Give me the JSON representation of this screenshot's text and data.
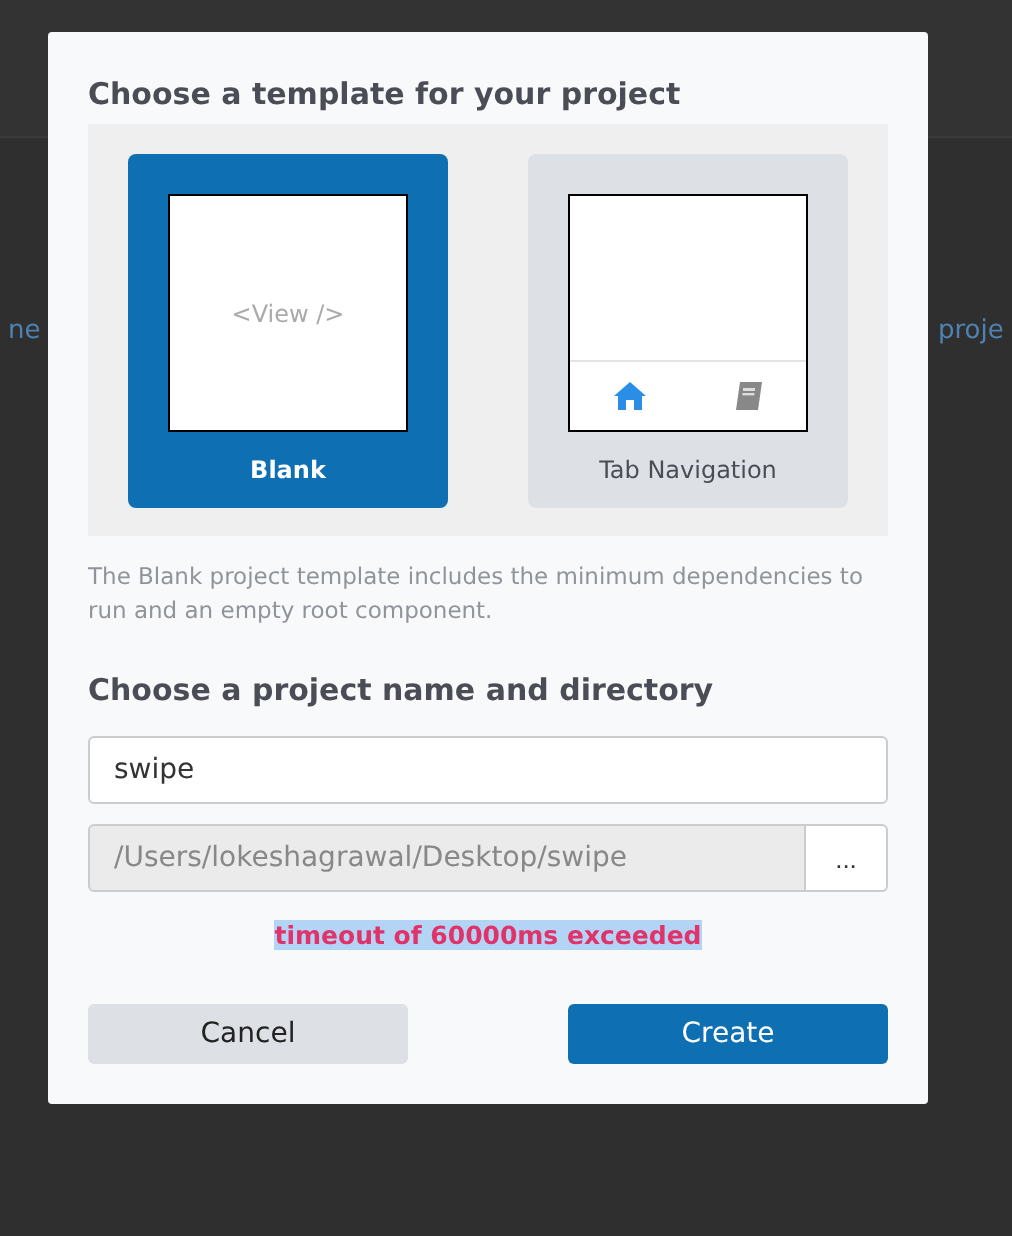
{
  "background_texts": [
    "ne",
    "proje"
  ],
  "dialog": {
    "template_heading": "Choose a template for your project",
    "templates": [
      {
        "name": "Blank",
        "selected": true,
        "kind": "blank",
        "preview_text": "<View />"
      },
      {
        "name": "Tab Navigation",
        "selected": false,
        "kind": "tabs"
      }
    ],
    "description": "The Blank project template includes the minimum dependencies to run and an empty root component.",
    "name_heading": "Choose a project name and directory",
    "name_field": {
      "value": "swipe"
    },
    "directory_field": {
      "value": "/Users/lokeshagrawal/Desktop/swipe",
      "disabled": true
    },
    "browse_button": "...",
    "error": "timeout of 60000ms exceeded",
    "buttons": [
      {
        "label": "Cancel",
        "kind": "secondary"
      },
      {
        "label": "Create",
        "kind": "primary"
      }
    ]
  }
}
